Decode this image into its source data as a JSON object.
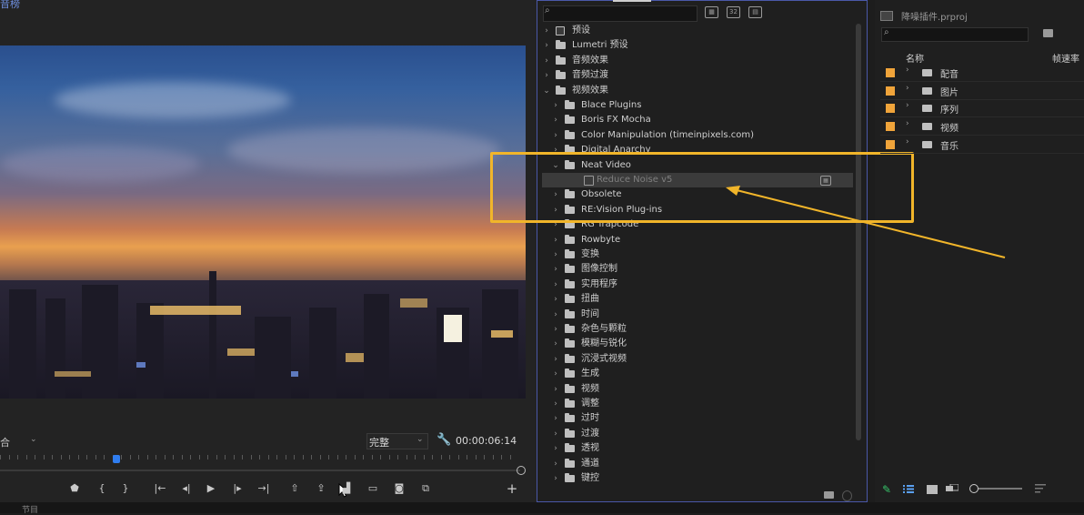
{
  "monitor": {
    "title": "音榜",
    "zoom_value": "合",
    "quality": "完整",
    "timecode": "00:00:06:14",
    "transport_buttons": [
      {
        "icon": "marker-icon",
        "glyph": "⬟"
      },
      {
        "icon": "mark-in-icon",
        "glyph": "{"
      },
      {
        "icon": "mark-out-icon",
        "glyph": "}"
      },
      {
        "icon": "go-to-in-icon",
        "glyph": "|←"
      },
      {
        "icon": "step-back-icon",
        "glyph": "◂|"
      },
      {
        "icon": "play-icon",
        "glyph": "▶"
      },
      {
        "icon": "step-forward-icon",
        "glyph": "|▸"
      },
      {
        "icon": "go-to-out-icon",
        "glyph": "→|"
      },
      {
        "icon": "lift-icon",
        "glyph": "⇧"
      },
      {
        "icon": "extract-icon",
        "glyph": "⇪"
      },
      {
        "icon": "trim-icon",
        "glyph": "▟"
      },
      {
        "icon": "safe-margins-icon",
        "glyph": "▭"
      },
      {
        "icon": "camera-icon",
        "glyph": "◙"
      },
      {
        "icon": "compare-icon",
        "glyph": "⧉"
      }
    ],
    "add_label": "+"
  },
  "effects": {
    "search_value": "",
    "tree": [
      {
        "label": "预设",
        "level": 0,
        "expanded": false,
        "icon": "presets-folder"
      },
      {
        "label": "Lumetri 预设",
        "level": 0,
        "expanded": false,
        "icon": "folder"
      },
      {
        "label": "音频效果",
        "level": 0,
        "expanded": false,
        "icon": "folder"
      },
      {
        "label": "音频过渡",
        "level": 0,
        "expanded": false,
        "icon": "folder"
      },
      {
        "label": "视频效果",
        "level": 0,
        "expanded": true,
        "icon": "folder"
      },
      {
        "label": "Blace Plugins",
        "level": 1,
        "expanded": false,
        "icon": "folder"
      },
      {
        "label": "Boris FX Mocha",
        "level": 1,
        "expanded": false,
        "icon": "folder"
      },
      {
        "label": "Color Manipulation (timeinpixels.com)",
        "level": 1,
        "expanded": false,
        "icon": "folder"
      },
      {
        "label": "Digital Anarchy",
        "level": 1,
        "expanded": false,
        "icon": "folder"
      },
      {
        "label": "Neat Video",
        "level": 1,
        "expanded": true,
        "icon": "folder"
      },
      {
        "label": "Reduce Noise v5",
        "level": 2,
        "expanded": null,
        "icon": "effect",
        "selected": true
      },
      {
        "label": "Obsolete",
        "level": 1,
        "expanded": false,
        "icon": "folder"
      },
      {
        "label": "RE:Vision Plug-ins",
        "level": 1,
        "expanded": false,
        "icon": "folder"
      },
      {
        "label": "RG Trapcode",
        "level": 1,
        "expanded": false,
        "icon": "folder"
      },
      {
        "label": "Rowbyte",
        "level": 1,
        "expanded": false,
        "icon": "folder"
      },
      {
        "label": "变换",
        "level": 1,
        "expanded": false,
        "icon": "folder"
      },
      {
        "label": "图像控制",
        "level": 1,
        "expanded": false,
        "icon": "folder"
      },
      {
        "label": "实用程序",
        "level": 1,
        "expanded": false,
        "icon": "folder"
      },
      {
        "label": "扭曲",
        "level": 1,
        "expanded": false,
        "icon": "folder"
      },
      {
        "label": "时间",
        "level": 1,
        "expanded": false,
        "icon": "folder"
      },
      {
        "label": "杂色与颗粒",
        "level": 1,
        "expanded": false,
        "icon": "folder"
      },
      {
        "label": "模糊与锐化",
        "level": 1,
        "expanded": false,
        "icon": "folder"
      },
      {
        "label": "沉浸式视频",
        "level": 1,
        "expanded": false,
        "icon": "folder"
      },
      {
        "label": "生成",
        "level": 1,
        "expanded": false,
        "icon": "folder"
      },
      {
        "label": "视频",
        "level": 1,
        "expanded": false,
        "icon": "folder"
      },
      {
        "label": "调整",
        "level": 1,
        "expanded": false,
        "icon": "folder"
      },
      {
        "label": "过时",
        "level": 1,
        "expanded": false,
        "icon": "folder"
      },
      {
        "label": "过渡",
        "level": 1,
        "expanded": false,
        "icon": "folder"
      },
      {
        "label": "透视",
        "level": 1,
        "expanded": false,
        "icon": "folder"
      },
      {
        "label": "通道",
        "level": 1,
        "expanded": false,
        "icon": "folder"
      },
      {
        "label": "键控",
        "level": 1,
        "expanded": false,
        "icon": "folder"
      }
    ],
    "header_buttons": [
      "accelerated-effects-icon",
      "32bit-effects-icon",
      "yuv-effects-icon"
    ]
  },
  "project": {
    "name": "降噪插件.prproj",
    "search_value": "",
    "col_name": "名称",
    "col_framerate": "帧速率",
    "bins": [
      {
        "label": "配音",
        "color": "#f0a43a"
      },
      {
        "label": "图片",
        "color": "#f0a43a"
      },
      {
        "label": "序列",
        "color": "#f0a43a"
      },
      {
        "label": "视频",
        "color": "#f0a43a"
      },
      {
        "label": "音乐",
        "color": "#f0a43a"
      }
    ]
  },
  "annotation": {
    "color": "#f1b52a"
  },
  "bottom": {
    "label": "节目"
  }
}
